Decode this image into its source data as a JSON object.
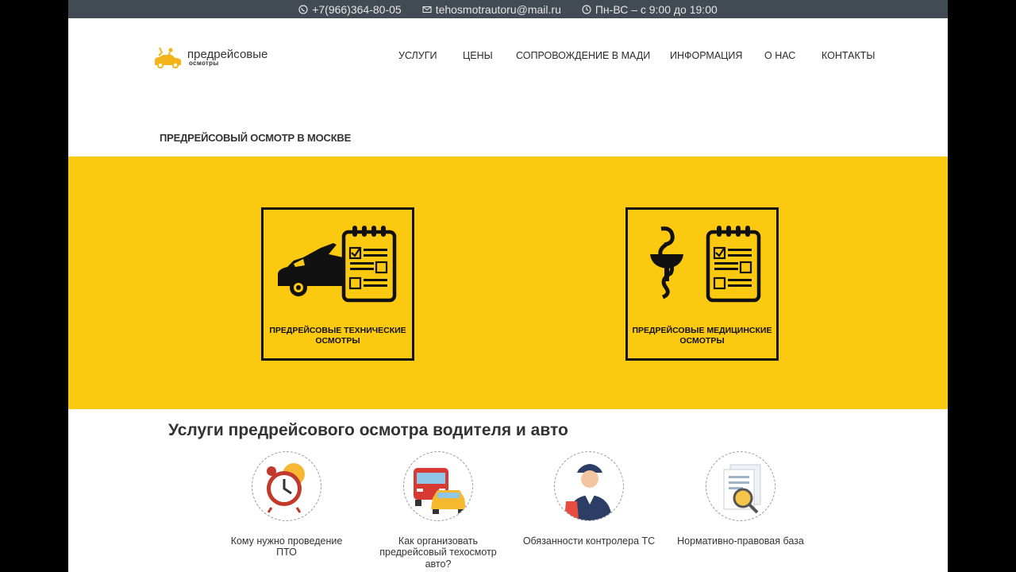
{
  "topbar": {
    "phone": "+7(966)364-80-05",
    "email": "tehosmotrautoru@mail.ru",
    "hours": "Пн-ВС – с 9:00 до 19:00"
  },
  "logo": {
    "main": "предрейсовые",
    "sub": "осмотры"
  },
  "nav": {
    "items": [
      "УСЛУГИ",
      "ЦЕНЫ",
      "СОПРОВОЖДЕНИЕ В МАДИ",
      "ИНФОРМАЦИЯ",
      "О НАС",
      "КОНТАКТЫ"
    ]
  },
  "page_heading": "ПРЕДРЕЙСОВЫЙ ОСМОТР В МОСКВЕ",
  "hero": {
    "cards": [
      {
        "line1": "ПРЕДРЕЙСОВЫЕ ТЕХНИЧЕСКИЕ",
        "line2": "ОСМОТРЫ"
      },
      {
        "line1": "ПРЕДРЕЙСОВЫЕ МЕДИЦИНСКИЕ",
        "line2": "ОСМОТРЫ"
      }
    ]
  },
  "services": {
    "title": "Услуги предрейсового осмотра водителя и авто",
    "items": [
      {
        "line1": "Кому нужно проведение",
        "line2": "ПТО",
        "line3": ""
      },
      {
        "line1": "Как организовать",
        "line2": "предрейсовый техосмотр",
        "line3": "авто?"
      },
      {
        "line1": "Обязанности контролера ТС",
        "line2": "",
        "line3": ""
      },
      {
        "line1": "Нормативно-правовая база",
        "line2": "",
        "line3": ""
      }
    ]
  },
  "colors": {
    "accent": "#fbc90f",
    "topbar": "#424a53"
  }
}
